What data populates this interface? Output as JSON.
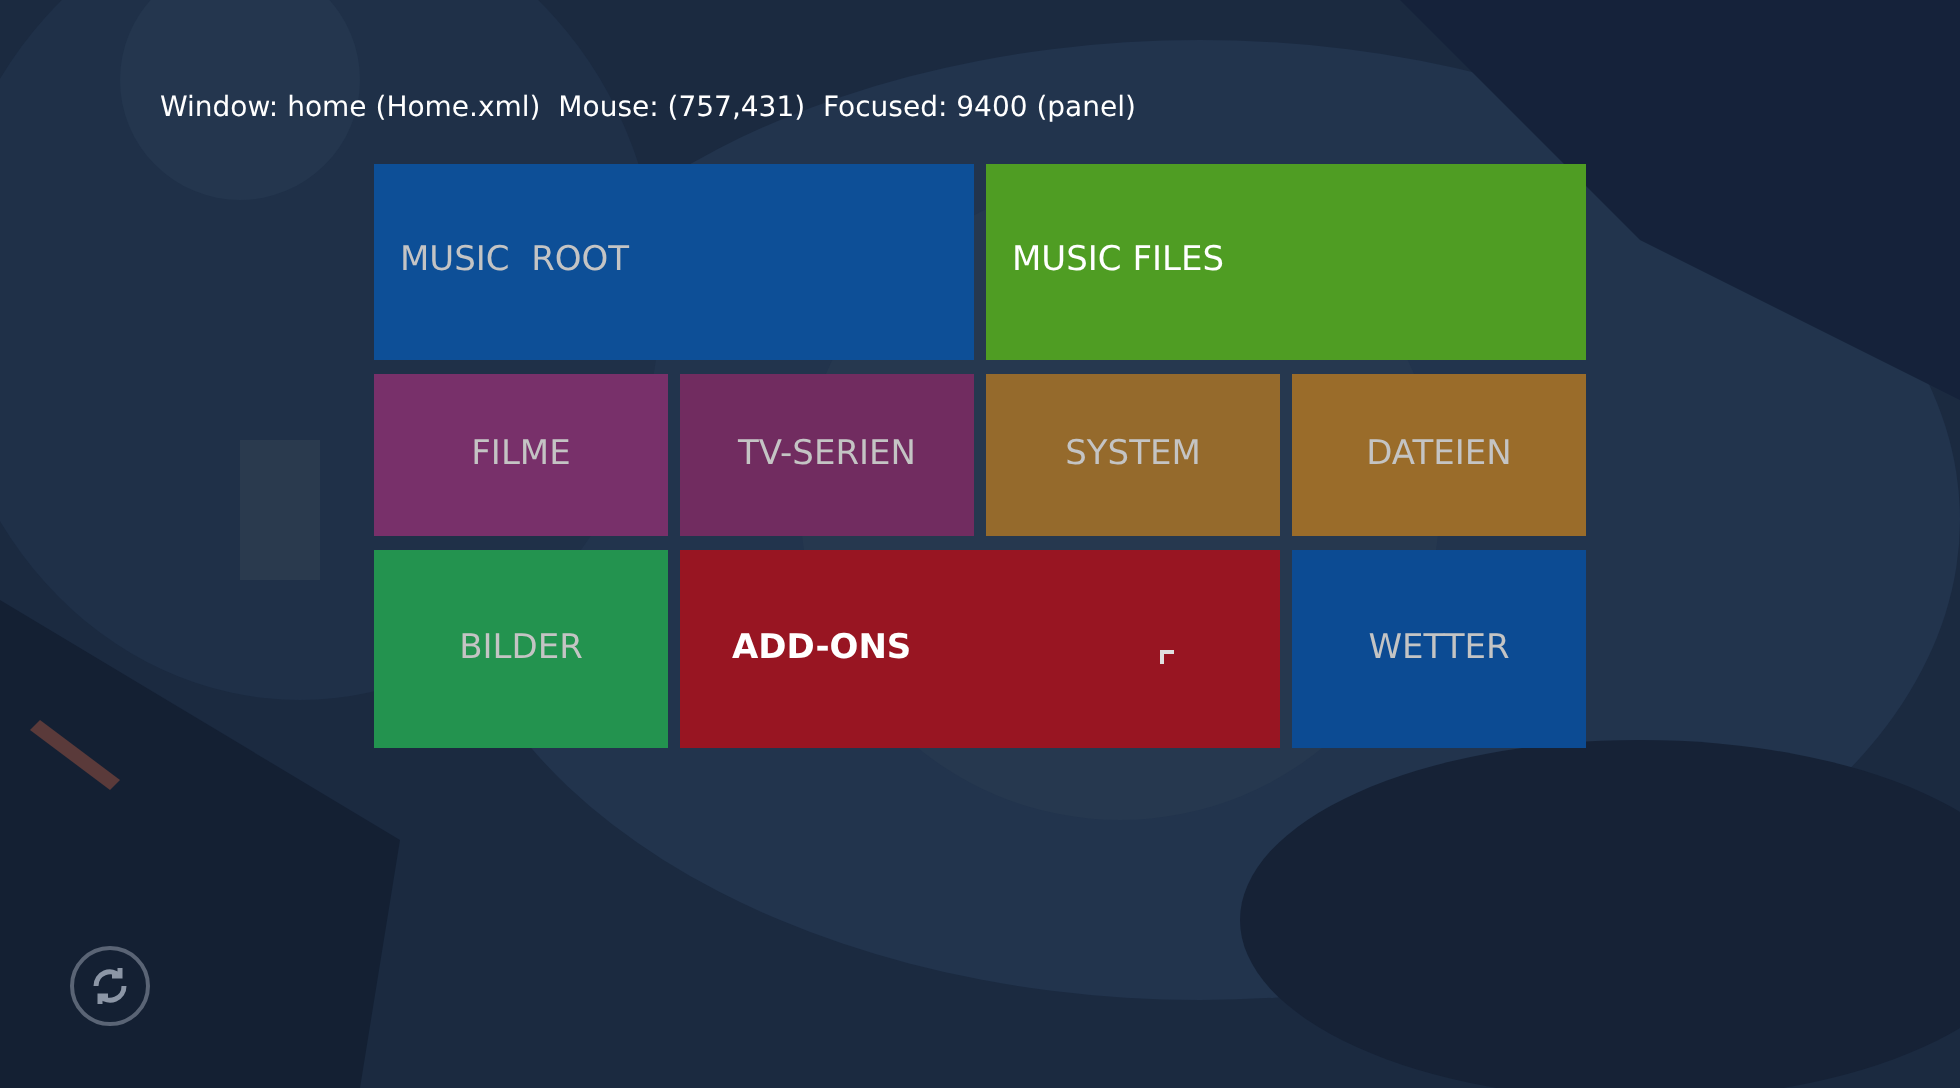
{
  "debug_info": "Window: home (Home.xml)  Mouse: (757,431)  Focused: 9400 (panel)",
  "tiles": [
    {
      "label": "MUSIC  ROOT",
      "color": "#0d4f97",
      "selected": false,
      "hovered": false
    },
    {
      "label": "MUSIC FILES",
      "color": "#4f9d23",
      "selected": false,
      "hovered": true
    },
    {
      "label": "FILME",
      "color": "#78306a",
      "selected": false,
      "hovered": false
    },
    {
      "label": "TV-SERIEN",
      "color": "#712c60",
      "selected": false,
      "hovered": false
    },
    {
      "label": "SYSTEM",
      "color": "#956a2c",
      "selected": false,
      "hovered": false
    },
    {
      "label": "DATEIEN",
      "color": "#9a6c2a",
      "selected": false,
      "hovered": false
    },
    {
      "label": "BILDER",
      "color": "#23934f",
      "selected": false,
      "hovered": false
    },
    {
      "label": "ADD-ONS",
      "color": "#981522",
      "selected": true,
      "hovered": false
    },
    {
      "label": "WETTER",
      "color": "#0c4b93",
      "selected": false,
      "hovered": false
    }
  ]
}
